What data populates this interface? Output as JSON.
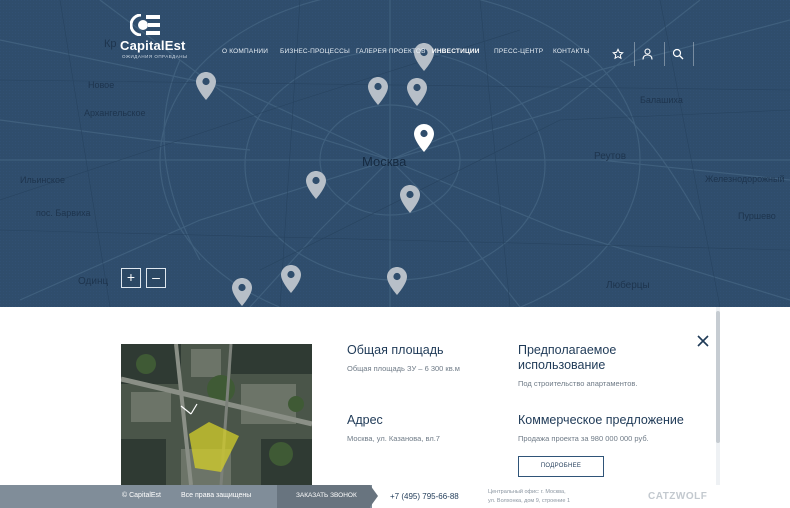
{
  "brand": {
    "name": "CapitalEst",
    "tagline": "ОЖИДАНИЯ ОПРАВДАНЫ"
  },
  "nav": {
    "items": [
      {
        "label": "О КОМПАНИИ"
      },
      {
        "label": "БИЗНЕС-ПРОЦЕССЫ"
      },
      {
        "label": "ГАЛЕРЕЯ ПРОЕКТОВ"
      },
      {
        "label": "ИНВЕСТИЦИИ",
        "active": true
      },
      {
        "label": "ПРЕСС-ЦЕНТР"
      },
      {
        "label": "КОНТАКТЫ"
      }
    ]
  },
  "header_icons": [
    "star-icon",
    "user-icon",
    "search-icon"
  ],
  "map": {
    "labels": {
      "city": "Москва",
      "reutov": "Реутов",
      "balashikha": "Балашиха",
      "lyubertsy": "Люберцы",
      "odintsovo": "Одинц",
      "zheleznodorozhny": "Железнодорожный",
      "putsevo": "Пуршево",
      "novoe": "Новое",
      "arkhangelskoe": "Архангельское",
      "barvikha": "пос. Барвиха",
      "ilinskoe": "Ильинское",
      "krasnogorsk": "Кр"
    },
    "zoom_in": "+",
    "zoom_out": "–",
    "colors": {
      "map_tint": "#2f4d6c",
      "pin": "#b7bfc8",
      "pin_active": "#ffffff"
    }
  },
  "property": {
    "area_title": "Общая площадь",
    "area_value": "Общая площадь ЗУ – 6 300 кв.м",
    "use_title": "Предполагаемое использование",
    "use_value": "Под строительство апартаментов.",
    "address_title": "Адрес",
    "address_value": "Москва, ул. Казанова, вл.7",
    "offer_title": "Коммерческое предложение",
    "offer_value": "Продажа проекта за 980 000 000 руб.",
    "more_button": "ПОДРОБНЕЕ"
  },
  "footer": {
    "copyright": "© CapitalEst",
    "rights": "Все права защищены",
    "callback": "ЗАКАЗАТЬ ЗВОНОК",
    "phone": "+7 (495) 795-66-88",
    "office_line1": "Центральный офис: г. Москва,",
    "office_line2": "ул. Волхонка, дом 9, строение 1",
    "dev_brand": "CATZWOLF"
  },
  "colors": {
    "accent": "#1f3a57",
    "footer_grey": "#808d99",
    "footer_dark": "#68747f"
  }
}
